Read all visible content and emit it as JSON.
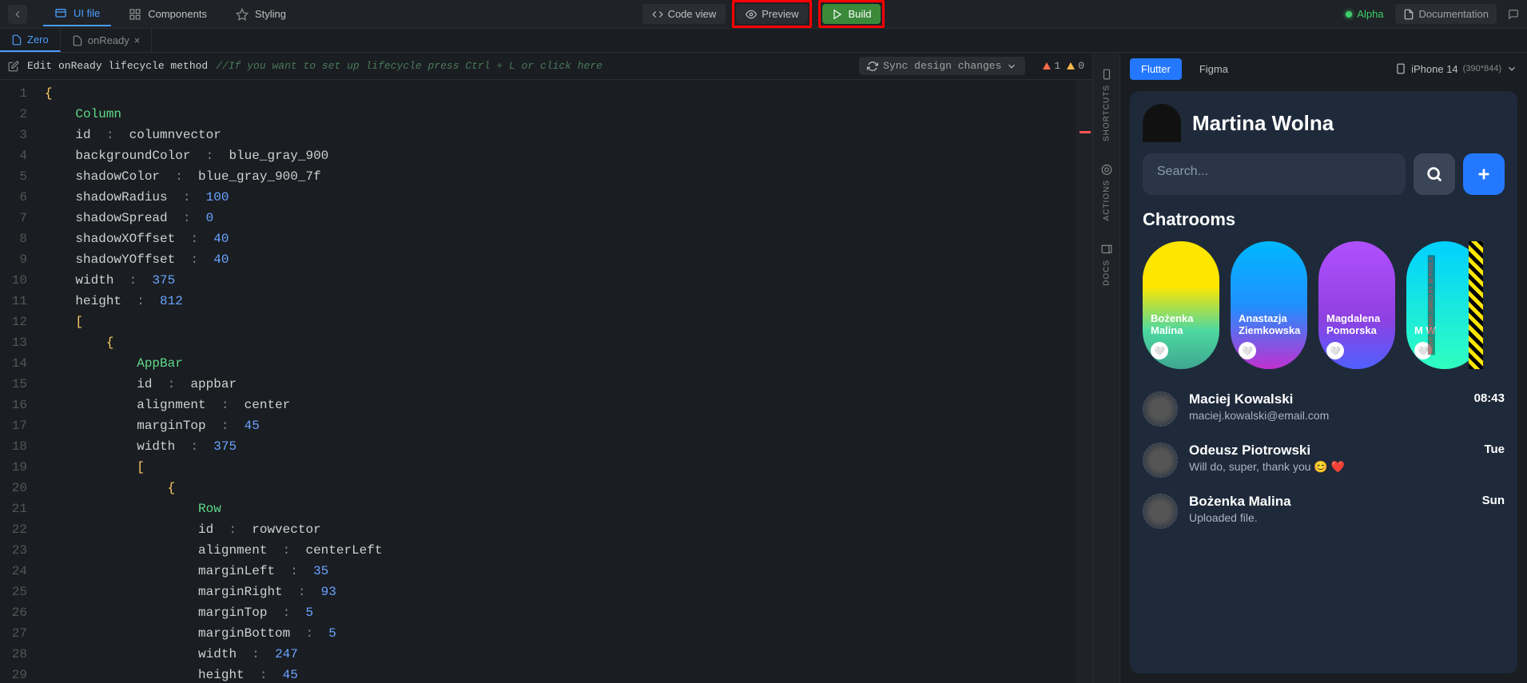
{
  "toolbar": {
    "nav": {
      "ui_file": "UI file",
      "components": "Components",
      "styling": "Styling"
    },
    "actions": {
      "code_view": "Code view",
      "preview": "Preview",
      "build": "Build"
    },
    "alpha": "Alpha",
    "documentation": "Documentation"
  },
  "fileTabs": {
    "zero": "Zero",
    "onReady": "onReady"
  },
  "editHeader": {
    "prefix": "Edit onReady lifecycle method",
    "hint": "//If you want to set up lifecycle press Ctrl + L or click here",
    "sync": "Sync design changes",
    "err_count": "1",
    "warn_count": "0"
  },
  "sideRails": {
    "shortcuts": "SHORTCUTS",
    "actions": "ACTIONS",
    "docs": "DOCS"
  },
  "previewHeader": {
    "flutter": "Flutter",
    "figma": "Figma",
    "device": "iPhone 14",
    "dims": "(390*844)"
  },
  "phone": {
    "title": "Martina Wolna",
    "search_placeholder": "Search...",
    "section": "Chatrooms",
    "rooms": [
      {
        "name": "Bożenka Malina"
      },
      {
        "name": "Anastazja Ziemkowska"
      },
      {
        "name": "Magdalena Pomorska"
      },
      {
        "name": "M W"
      }
    ],
    "overflow_text": "RIGHT OVERFLOWED BY 38 PIXELS",
    "chats": [
      {
        "name": "Maciej Kowalski",
        "sub": "maciej.kowalski@email.com",
        "time": "08:43"
      },
      {
        "name": "Odeusz Piotrowski",
        "sub": "Will do, super, thank you 😊 ❤️",
        "time": "Tue"
      },
      {
        "name": "Bożenka Malina",
        "sub": "Uploaded file.",
        "time": "Sun"
      }
    ]
  },
  "code": {
    "lines": [
      {
        "n": 1,
        "indent": 0,
        "tokens": [
          {
            "t": "{",
            "c": "c-brace"
          }
        ]
      },
      {
        "n": 2,
        "indent": 1,
        "tokens": [
          {
            "t": "Column",
            "c": "c-keyword"
          }
        ]
      },
      {
        "n": 3,
        "indent": 1,
        "tokens": [
          {
            "t": "id",
            "c": "c-prop"
          },
          {
            "t": "  :  ",
            "c": "c-colon"
          },
          {
            "t": "columnvector",
            "c": "c-val"
          }
        ]
      },
      {
        "n": 4,
        "indent": 1,
        "tokens": [
          {
            "t": "backgroundColor",
            "c": "c-prop"
          },
          {
            "t": "  :  ",
            "c": "c-colon"
          },
          {
            "t": "blue_gray_900",
            "c": "c-val"
          }
        ]
      },
      {
        "n": 5,
        "indent": 1,
        "tokens": [
          {
            "t": "shadowColor",
            "c": "c-prop"
          },
          {
            "t": "  :  ",
            "c": "c-colon"
          },
          {
            "t": "blue_gray_900_7f",
            "c": "c-val"
          }
        ]
      },
      {
        "n": 6,
        "indent": 1,
        "tokens": [
          {
            "t": "shadowRadius",
            "c": "c-prop"
          },
          {
            "t": "  :  ",
            "c": "c-colon"
          },
          {
            "t": "100",
            "c": "c-num"
          }
        ]
      },
      {
        "n": 7,
        "indent": 1,
        "tokens": [
          {
            "t": "shadowSpread",
            "c": "c-prop"
          },
          {
            "t": "  :  ",
            "c": "c-colon"
          },
          {
            "t": "0",
            "c": "c-num"
          }
        ]
      },
      {
        "n": 8,
        "indent": 1,
        "tokens": [
          {
            "t": "shadowXOffset",
            "c": "c-prop"
          },
          {
            "t": "  :  ",
            "c": "c-colon"
          },
          {
            "t": "40",
            "c": "c-num"
          }
        ]
      },
      {
        "n": 9,
        "indent": 1,
        "tokens": [
          {
            "t": "shadowYOffset",
            "c": "c-prop"
          },
          {
            "t": "  :  ",
            "c": "c-colon"
          },
          {
            "t": "40",
            "c": "c-num"
          }
        ]
      },
      {
        "n": 10,
        "indent": 1,
        "tokens": [
          {
            "t": "width",
            "c": "c-prop"
          },
          {
            "t": "  :  ",
            "c": "c-colon"
          },
          {
            "t": "375",
            "c": "c-num"
          }
        ]
      },
      {
        "n": 11,
        "indent": 1,
        "tokens": [
          {
            "t": "height",
            "c": "c-prop"
          },
          {
            "t": "  :  ",
            "c": "c-colon"
          },
          {
            "t": "812",
            "c": "c-num"
          }
        ]
      },
      {
        "n": 12,
        "indent": 1,
        "tokens": [
          {
            "t": "[",
            "c": "c-brace"
          }
        ]
      },
      {
        "n": 13,
        "indent": 2,
        "tokens": [
          {
            "t": "{",
            "c": "c-brace"
          }
        ]
      },
      {
        "n": 14,
        "indent": 3,
        "tokens": [
          {
            "t": "AppBar",
            "c": "c-keyword"
          }
        ]
      },
      {
        "n": 15,
        "indent": 3,
        "tokens": [
          {
            "t": "id",
            "c": "c-prop"
          },
          {
            "t": "  :  ",
            "c": "c-colon"
          },
          {
            "t": "appbar",
            "c": "c-val"
          }
        ]
      },
      {
        "n": 16,
        "indent": 3,
        "tokens": [
          {
            "t": "alignment",
            "c": "c-prop"
          },
          {
            "t": "  :  ",
            "c": "c-colon"
          },
          {
            "t": "center",
            "c": "c-val"
          }
        ]
      },
      {
        "n": 17,
        "indent": 3,
        "tokens": [
          {
            "t": "marginTop",
            "c": "c-prop"
          },
          {
            "t": "  :  ",
            "c": "c-colon"
          },
          {
            "t": "45",
            "c": "c-num"
          }
        ]
      },
      {
        "n": 18,
        "indent": 3,
        "tokens": [
          {
            "t": "width",
            "c": "c-prop"
          },
          {
            "t": "  :  ",
            "c": "c-colon"
          },
          {
            "t": "375",
            "c": "c-num"
          }
        ]
      },
      {
        "n": 19,
        "indent": 3,
        "tokens": [
          {
            "t": "[",
            "c": "c-brace"
          }
        ]
      },
      {
        "n": 20,
        "indent": 4,
        "tokens": [
          {
            "t": "{",
            "c": "c-brace"
          }
        ]
      },
      {
        "n": 21,
        "indent": 5,
        "tokens": [
          {
            "t": "Row",
            "c": "c-keyword"
          }
        ]
      },
      {
        "n": 22,
        "indent": 5,
        "tokens": [
          {
            "t": "id",
            "c": "c-prop"
          },
          {
            "t": "  :  ",
            "c": "c-colon"
          },
          {
            "t": "rowvector",
            "c": "c-val"
          }
        ]
      },
      {
        "n": 23,
        "indent": 5,
        "tokens": [
          {
            "t": "alignment",
            "c": "c-prop"
          },
          {
            "t": "  :  ",
            "c": "c-colon"
          },
          {
            "t": "centerLeft",
            "c": "c-val"
          }
        ]
      },
      {
        "n": 24,
        "indent": 5,
        "tokens": [
          {
            "t": "marginLeft",
            "c": "c-prop"
          },
          {
            "t": "  :  ",
            "c": "c-colon"
          },
          {
            "t": "35",
            "c": "c-num"
          }
        ]
      },
      {
        "n": 25,
        "indent": 5,
        "tokens": [
          {
            "t": "marginRight",
            "c": "c-prop"
          },
          {
            "t": "  :  ",
            "c": "c-colon"
          },
          {
            "t": "93",
            "c": "c-num"
          }
        ]
      },
      {
        "n": 26,
        "indent": 5,
        "tokens": [
          {
            "t": "marginTop",
            "c": "c-prop"
          },
          {
            "t": "  :  ",
            "c": "c-colon"
          },
          {
            "t": "5",
            "c": "c-num"
          }
        ]
      },
      {
        "n": 27,
        "indent": 5,
        "tokens": [
          {
            "t": "marginBottom",
            "c": "c-prop"
          },
          {
            "t": "  :  ",
            "c": "c-colon"
          },
          {
            "t": "5",
            "c": "c-num"
          }
        ]
      },
      {
        "n": 28,
        "indent": 5,
        "tokens": [
          {
            "t": "width",
            "c": "c-prop"
          },
          {
            "t": "  :  ",
            "c": "c-colon"
          },
          {
            "t": "247",
            "c": "c-num"
          }
        ]
      },
      {
        "n": 29,
        "indent": 5,
        "tokens": [
          {
            "t": "height",
            "c": "c-prop"
          },
          {
            "t": "  :  ",
            "c": "c-colon"
          },
          {
            "t": "45",
            "c": "c-num"
          }
        ]
      }
    ]
  }
}
